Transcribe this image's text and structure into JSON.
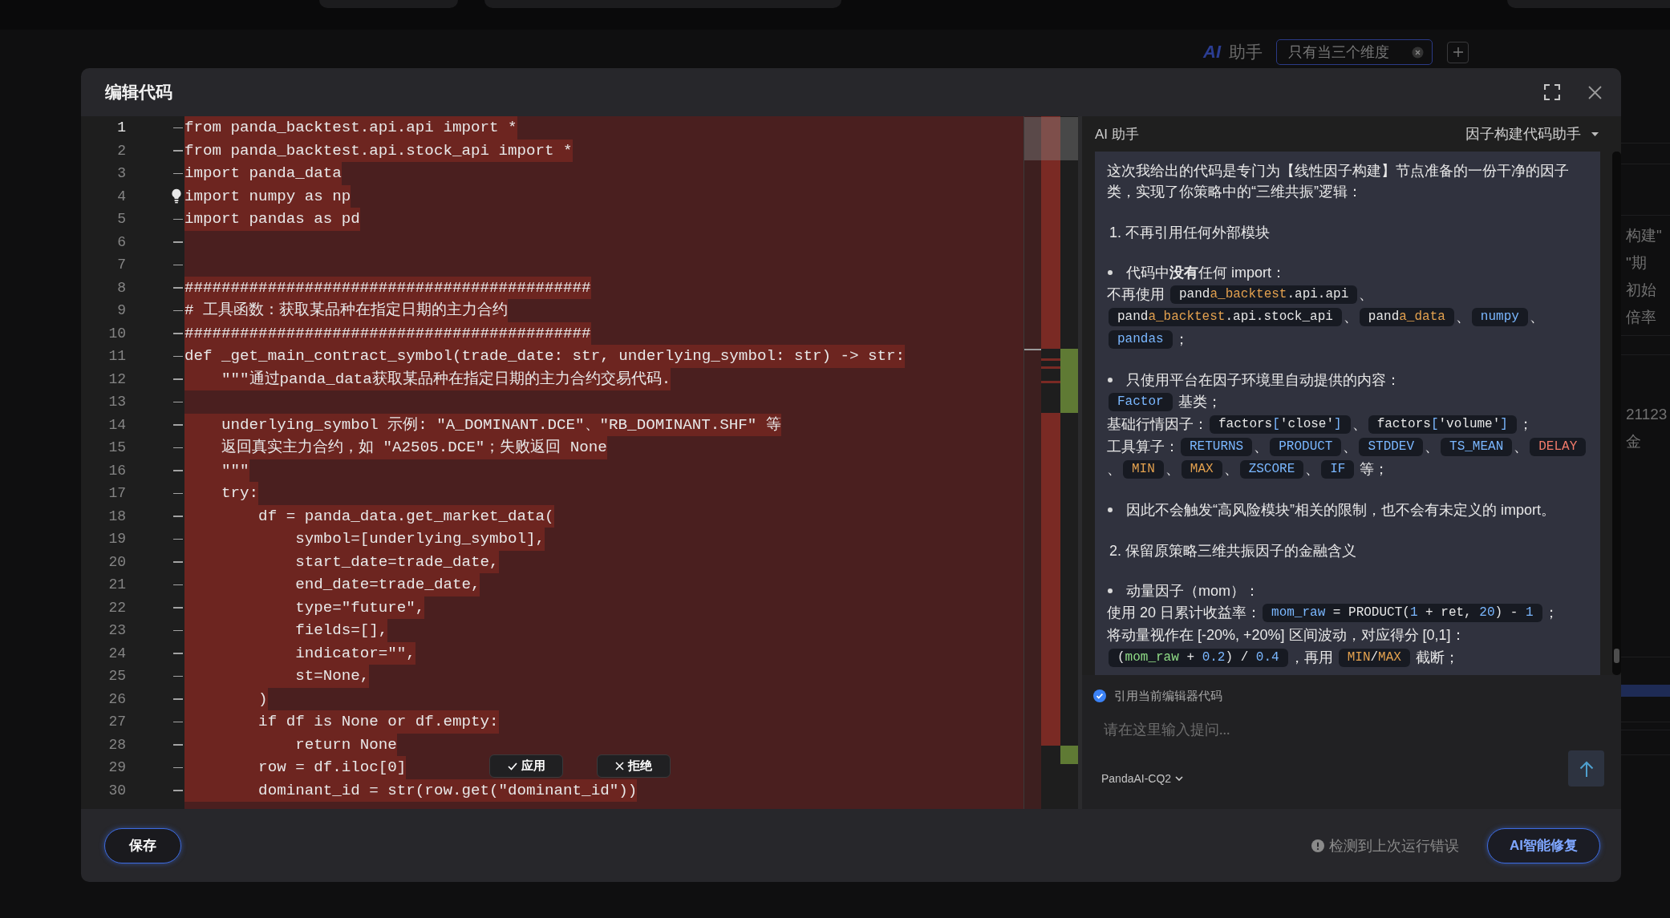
{
  "background": {
    "brand": "AI",
    "title": "助手",
    "tag": {
      "label": "只有当三个维度"
    },
    "side_groups": [
      [
        "构建\"",
        "\"期",
        "初始",
        "倍率"
      ],
      [
        "21123",
        "金"
      ]
    ]
  },
  "dialog": {
    "title": "编辑代码",
    "editor": {
      "lines": [
        {
          "number": "1",
          "code": "from panda_backtest.api.api import *",
          "removed": true,
          "current": true,
          "lightbulb": false
        },
        {
          "number": "2",
          "code": "from panda_backtest.api.stock_api import *",
          "removed": true,
          "current": false,
          "lightbulb": false
        },
        {
          "number": "3",
          "code": "import panda_data",
          "removed": true,
          "current": false,
          "lightbulb": false
        },
        {
          "number": "4",
          "code": "import numpy as np",
          "removed": true,
          "current": false,
          "lightbulb": true
        },
        {
          "number": "5",
          "code": "import pandas as pd",
          "removed": true,
          "current": false,
          "lightbulb": false
        },
        {
          "number": "6",
          "removed": true,
          "current": false,
          "lightbulb": false
        },
        {
          "number": "7",
          "removed": true,
          "current": false,
          "lightbulb": false
        },
        {
          "number": "8",
          "code": "############################################",
          "removed": true,
          "current": false,
          "lightbulb": false
        },
        {
          "number": "9",
          "code": "# 工具函数：获取某品种在指定日期的主力合约",
          "removed": true,
          "current": false,
          "lightbulb": false
        },
        {
          "number": "10",
          "code": "############################################",
          "removed": true,
          "current": false,
          "lightbulb": false
        },
        {
          "number": "11",
          "code": "def _get_main_contract_symbol(trade_date: str, underlying_symbol: str) -> str:",
          "removed": true,
          "current": false,
          "lightbulb": false
        },
        {
          "number": "12",
          "code": "    \"\"\"通过panda_data获取某品种在指定日期的主力合约交易代码.",
          "removed": true,
          "current": false,
          "lightbulb": false
        },
        {
          "number": "13",
          "removed": true,
          "current": false,
          "lightbulb": false
        },
        {
          "number": "14",
          "code": "    underlying_symbol 示例: \"A_DOMINANT.DCE\"、\"RB_DOMINANT.SHF\" 等",
          "removed": true,
          "current": false,
          "lightbulb": false
        },
        {
          "number": "15",
          "code": "    返回真实主力合约，如 \"A2505.DCE\"；失败返回 None",
          "removed": true,
          "current": false,
          "lightbulb": false
        },
        {
          "number": "16",
          "code": "    \"\"\"",
          "removed": true,
          "current": false,
          "lightbulb": false
        },
        {
          "number": "17",
          "code": "    try:",
          "removed": true,
          "current": false,
          "lightbulb": false
        },
        {
          "number": "18",
          "code": "        df = panda_data.get_market_data(",
          "removed": true,
          "current": false,
          "lightbulb": false
        },
        {
          "number": "19",
          "code": "            symbol=[underlying_symbol],",
          "removed": true,
          "current": false,
          "lightbulb": false
        },
        {
          "number": "20",
          "code": "            start_date=trade_date,",
          "removed": true,
          "current": false,
          "lightbulb": false
        },
        {
          "number": "21",
          "code": "            end_date=trade_date,",
          "removed": true,
          "current": false,
          "lightbulb": false
        },
        {
          "number": "22",
          "code": "            type=\"future\",",
          "removed": true,
          "current": false,
          "lightbulb": false
        },
        {
          "number": "23",
          "code": "            fields=[],",
          "removed": true,
          "current": false,
          "lightbulb": false
        },
        {
          "number": "24",
          "code": "            indicator=\"\",",
          "removed": true,
          "current": false,
          "lightbulb": false
        },
        {
          "number": "25",
          "code": "            st=None,",
          "removed": true,
          "current": false,
          "lightbulb": false
        },
        {
          "number": "26",
          "code": "        )",
          "removed": true,
          "current": false,
          "lightbulb": false
        },
        {
          "number": "27",
          "code": "        if df is None or df.empty:",
          "removed": true,
          "current": false,
          "lightbulb": false
        },
        {
          "number": "28",
          "code": "            return None",
          "removed": true,
          "current": false,
          "lightbulb": false
        },
        {
          "number": "29",
          "code": "        row = df.iloc[0]",
          "removed": true,
          "current": false,
          "lightbulb": false
        },
        {
          "number": "30",
          "code": "        dominant_id = str(row.get(\"dominant_id\"))",
          "removed": true,
          "current": false,
          "lightbulb": false
        }
      ],
      "actions": [
        {
          "kind": "accept",
          "label": "应用"
        },
        {
          "kind": "reject",
          "label": "拒绝"
        }
      ]
    },
    "assistant": {
      "title": "AI 助手",
      "mode": "因子构建代码助手",
      "message": {
        "blocks": [
          {
            "kind": "paragraph",
            "text": "这次我给出的代码是专门为【线性因子构建】节点准备的一份干净的因子类，实现了你策略中的“三维共振”逻辑："
          },
          {
            "kind": "heading",
            "text": "1. 不再引用任何外部模块"
          },
          {
            "kind": "bullet",
            "text": "代码中**没有**任何 import："
          },
          {
            "kind": "line",
            "parts": [
              {
                "kind": "text",
                "text": "不再使用 "
              },
              {
                "kind": "code",
                "tokens": [
                  {
                    "kind": "plain",
                    "text": "pand"
                  },
                  {
                    "kind": "attribute",
                    "text": "a_backtest"
                  },
                  {
                    "kind": "plain",
                    "text": ".api.api"
                  }
                ]
              },
              {
                "kind": "text",
                "text": "、"
              }
            ]
          },
          {
            "kind": "line",
            "parts": [
              {
                "kind": "code",
                "tokens": [
                  {
                    "kind": "plain",
                    "text": "pand"
                  },
                  {
                    "kind": "attribute",
                    "text": "a_backtest"
                  },
                  {
                    "kind": "plain",
                    "text": ".api.stock_api"
                  }
                ]
              },
              {
                "kind": "text",
                "text": "、"
              },
              {
                "kind": "code",
                "tokens": [
                  {
                    "kind": "plain",
                    "text": "pand"
                  },
                  {
                    "kind": "attribute",
                    "text": "a_data"
                  }
                ]
              },
              {
                "kind": "text",
                "text": "、"
              },
              {
                "kind": "code",
                "tokens": [
                  {
                    "kind": "identifier",
                    "text": "numpy"
                  }
                ]
              },
              {
                "kind": "text",
                "text": "、"
              }
            ]
          },
          {
            "kind": "line",
            "parts": [
              {
                "kind": "code",
                "tokens": [
                  {
                    "kind": "identifier",
                    "text": "pandas"
                  }
                ]
              },
              {
                "kind": "text",
                "text": "；"
              }
            ]
          },
          {
            "kind": "bullet",
            "text": "只使用平台在因子环境里自动提供的内容："
          },
          {
            "kind": "line",
            "parts": [
              {
                "kind": "code",
                "tokens": [
                  {
                    "kind": "identifier",
                    "text": "Factor"
                  }
                ]
              },
              {
                "kind": "text",
                "text": " 基类；"
              }
            ]
          },
          {
            "kind": "line",
            "parts": [
              {
                "kind": "text",
                "text": "基础行情因子："
              },
              {
                "kind": "code",
                "tokens": [
                  {
                    "kind": "plain",
                    "text": "factors"
                  },
                  {
                    "kind": "identifier",
                    "text": "["
                  },
                  {
                    "kind": "plain",
                    "text": "'close'"
                  },
                  {
                    "kind": "identifier",
                    "text": "]"
                  }
                ]
              },
              {
                "kind": "text",
                "text": "、"
              },
              {
                "kind": "code",
                "tokens": [
                  {
                    "kind": "plain",
                    "text": "factors"
                  },
                  {
                    "kind": "identifier",
                    "text": "["
                  },
                  {
                    "kind": "plain",
                    "text": "'volume'"
                  },
                  {
                    "kind": "identifier",
                    "text": "]"
                  }
                ]
              },
              {
                "kind": "text",
                "text": "；"
              }
            ]
          },
          {
            "kind": "line",
            "parts": [
              {
                "kind": "text",
                "text": "工具算子："
              },
              {
                "kind": "code",
                "tokens": [
                  {
                    "kind": "identifier",
                    "text": "RETURNS"
                  }
                ]
              },
              {
                "kind": "text",
                "text": "、"
              },
              {
                "kind": "code",
                "tokens": [
                  {
                    "kind": "identifier",
                    "text": "PRODUCT"
                  }
                ]
              },
              {
                "kind": "text",
                "text": "、"
              },
              {
                "kind": "code",
                "tokens": [
                  {
                    "kind": "identifier",
                    "text": "STDDEV"
                  }
                ]
              },
              {
                "kind": "text",
                "text": "、"
              },
              {
                "kind": "code",
                "tokens": [
                  {
                    "kind": "identifier",
                    "text": "TS_MEAN"
                  }
                ]
              },
              {
                "kind": "text",
                "text": "、"
              },
              {
                "kind": "code",
                "tokens": [
                  {
                    "kind": "error",
                    "text": "DELAY"
                  }
                ]
              }
            ]
          },
          {
            "kind": "line",
            "parts": [
              {
                "kind": "text",
                "text": "、"
              },
              {
                "kind": "code",
                "tokens": [
                  {
                    "kind": "attribute",
                    "text": "MIN"
                  }
                ]
              },
              {
                "kind": "text",
                "text": "、"
              },
              {
                "kind": "code",
                "tokens": [
                  {
                    "kind": "attribute",
                    "text": "MAX"
                  }
                ]
              },
              {
                "kind": "text",
                "text": "、"
              },
              {
                "kind": "code",
                "tokens": [
                  {
                    "kind": "identifier",
                    "text": "ZSCORE"
                  }
                ]
              },
              {
                "kind": "text",
                "text": "、"
              },
              {
                "kind": "code",
                "tokens": [
                  {
                    "kind": "identifier",
                    "text": "IF"
                  }
                ]
              },
              {
                "kind": "text",
                "text": " 等；"
              }
            ]
          },
          {
            "kind": "bullet",
            "text": "因此不会触发“高风险模块”相关的限制，也不会有未定义的 import。"
          },
          {
            "kind": "heading",
            "text": "2. 保留原策略三维共振因子的金融含义"
          },
          {
            "kind": "bullet",
            "text": "动量因子（mom）："
          },
          {
            "kind": "line",
            "parts": [
              {
                "kind": "text",
                "text": "使用 20 日累计收益率："
              },
              {
                "kind": "code",
                "tokens": [
                  {
                    "kind": "identifier",
                    "text": "mom_raw"
                  },
                  {
                    "kind": "plain",
                    "text": " = PRODUCT("
                  },
                  {
                    "kind": "number",
                    "text": "1"
                  },
                  {
                    "kind": "plain",
                    "text": " + ret, "
                  },
                  {
                    "kind": "number",
                    "text": "20"
                  },
                  {
                    "kind": "plain",
                    "text": ") - "
                  },
                  {
                    "kind": "number",
                    "text": "1"
                  }
                ]
              },
              {
                "kind": "text",
                "text": "；"
              }
            ]
          },
          {
            "kind": "line",
            "parts": [
              {
                "kind": "text",
                "text": "将动量视作在 [-20%, +20%] 区间波动，对应得分 [0,1]："
              }
            ]
          },
          {
            "kind": "line",
            "parts": [
              {
                "kind": "code",
                "tokens": [
                  {
                    "kind": "plain",
                    "text": "("
                  },
                  {
                    "kind": "variable",
                    "text": "mom_raw"
                  },
                  {
                    "kind": "plain",
                    "text": " + "
                  },
                  {
                    "kind": "number",
                    "text": "0.2"
                  },
                  {
                    "kind": "plain",
                    "text": ") / "
                  },
                  {
                    "kind": "number",
                    "text": "0.4"
                  }
                ]
              },
              {
                "kind": "text",
                "text": "，再用 "
              },
              {
                "kind": "code",
                "tokens": [
                  {
                    "kind": "attribute",
                    "text": "MIN"
                  },
                  {
                    "kind": "plain",
                    "text": "/"
                  },
                  {
                    "kind": "attribute",
                    "text": "MAX"
                  }
                ]
              },
              {
                "kind": "text",
                "text": " 截断；"
              }
            ]
          }
        ]
      },
      "use_editor_code": {
        "label": "引用当前编辑器代码",
        "checked": true
      },
      "input": {
        "placeholder": "请在这里输入提问..."
      },
      "model": "PandaAI-CQ2"
    },
    "footer": {
      "save": "保存",
      "notice": "检测到上次运行错误",
      "fix": "AI智能修复"
    }
  }
}
